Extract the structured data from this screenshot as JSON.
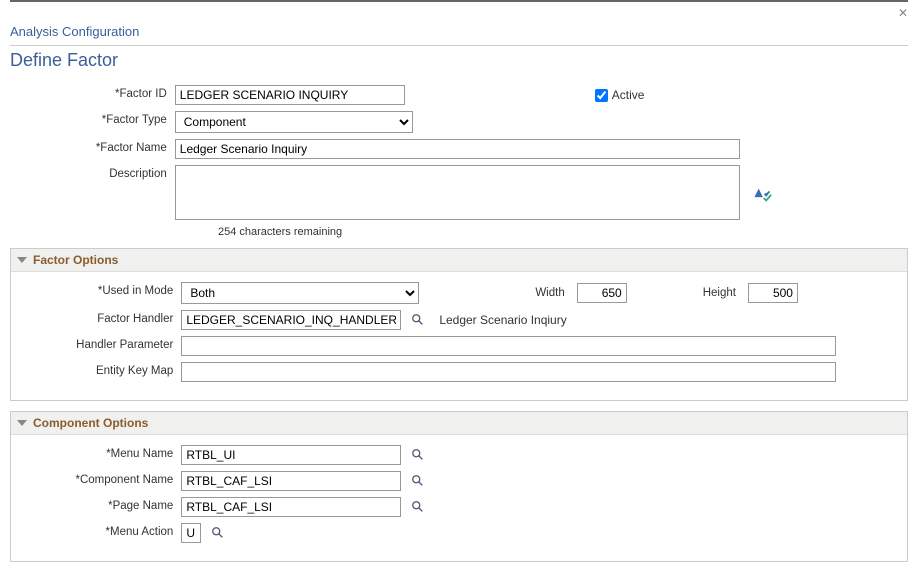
{
  "breadcrumb": "Analysis Configuration",
  "page_title": "Define Factor",
  "header": {
    "labels": {
      "factor_id": "Factor ID",
      "factor_type": "Factor Type",
      "factor_name": "Factor Name",
      "description": "Description",
      "active": "Active"
    },
    "factor_id": "LEDGER SCENARIO INQUIRY",
    "factor_type": "Component",
    "factor_name": "Ledger Scenario Inquiry",
    "description": "",
    "active_checked": true,
    "char_remaining": "254 characters remaining"
  },
  "factor_options": {
    "title": "Factor Options",
    "labels": {
      "used_in_mode": "Used in Mode",
      "width": "Width",
      "height": "Height",
      "factor_handler": "Factor Handler",
      "handler_parameter": "Handler Parameter",
      "entity_key_map": "Entity Key Map"
    },
    "used_in_mode": "Both",
    "width": "650",
    "height": "500",
    "factor_handler": "LEDGER_SCENARIO_INQ_HANDLER",
    "factor_handler_desc": "Ledger Scenario Inqiury",
    "handler_parameter": "",
    "entity_key_map": ""
  },
  "component_options": {
    "title": "Component Options",
    "labels": {
      "menu_name": "Menu Name",
      "component_name": "Component Name",
      "page_name": "Page Name",
      "menu_action": "Menu Action"
    },
    "menu_name": "RTBL_UI",
    "component_name": "RTBL_CAF_LSI",
    "page_name": "RTBL_CAF_LSI",
    "menu_action": "U"
  }
}
